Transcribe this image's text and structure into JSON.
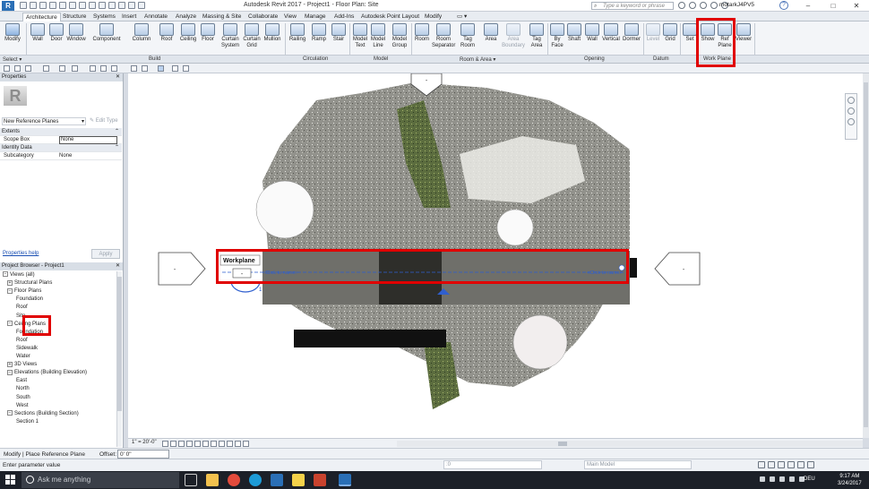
{
  "titlebar": {
    "app_letter": "R",
    "title": "Autodesk Revit 2017 -    Project1 - Floor Plan: Site",
    "search_placeholder": "Type a keyword or phrase",
    "user": "motarkJ4PV5",
    "help": "?",
    "min": "–",
    "max": "□",
    "close": "✕"
  },
  "tabs": [
    "Architecture",
    "Structure",
    "Systems",
    "Insert",
    "Annotate",
    "Analyze",
    "Massing & Site",
    "Collaborate",
    "View",
    "Manage",
    "Add-Ins",
    "Autodesk Point Layout",
    "Modify"
  ],
  "ribbon": {
    "modify": "Modify",
    "select": "Select ▾",
    "build": [
      "Wall",
      "Door",
      "Window",
      "Component",
      "Column",
      "Roof",
      "Ceiling",
      "Floor",
      "Curtain System",
      "Curtain Grid",
      "Mullion"
    ],
    "circulation": [
      "Railing",
      "Ramp",
      "Stair"
    ],
    "model": [
      "Model Text",
      "Model Line",
      "Model Group"
    ],
    "room_area": [
      "Room",
      "Room Separator",
      "Tag Room",
      "Area",
      "Area Boundary",
      "Tag Area"
    ],
    "opening": [
      "By Face",
      "Shaft",
      "Wall",
      "Vertical",
      "Dormer"
    ],
    "datum": [
      "Level",
      "Grid"
    ],
    "work_plane": [
      "Set",
      "Show",
      "Ref Plane",
      "Viewer"
    ],
    "panel_labels": {
      "build": "Build",
      "circulation": "Circulation",
      "model": "Model",
      "room_area": "Room & Area ▾",
      "opening": "Opening",
      "datum": "Datum",
      "work_plane": "Work Plane"
    }
  },
  "properties": {
    "header": "Properties",
    "logo": "R",
    "type": "New Reference Planes",
    "edit_type": "Edit Type",
    "groups": [
      {
        "name": "Extents",
        "rows": [
          {
            "k": "Scope Box",
            "v": "None",
            "boxed": true
          }
        ]
      },
      {
        "name": "Identity Data",
        "rows": [
          {
            "k": "Subcategory",
            "v": "None",
            "boxed": false
          }
        ]
      }
    ],
    "help_link": "Properties help",
    "apply": "Apply"
  },
  "browser": {
    "header": "Project Browser - Project1",
    "items": [
      {
        "label": "Views (all)",
        "indent": 0,
        "tg": "−"
      },
      {
        "label": "Structural Plans",
        "indent": 1,
        "tg": "+"
      },
      {
        "label": "Floor Plans",
        "indent": 1,
        "tg": "−"
      },
      {
        "label": "Foundation",
        "indent": 3,
        "tg": ""
      },
      {
        "label": "Roof",
        "indent": 3,
        "tg": ""
      },
      {
        "label": "Site",
        "indent": 3,
        "tg": "",
        "selected": true
      },
      {
        "label": "Ceiling Plans",
        "indent": 1,
        "tg": "−"
      },
      {
        "label": "Foundation",
        "indent": 3,
        "tg": ""
      },
      {
        "label": "Roof",
        "indent": 3,
        "tg": ""
      },
      {
        "label": "Sidewalk",
        "indent": 3,
        "tg": ""
      },
      {
        "label": "Water",
        "indent": 3,
        "tg": ""
      },
      {
        "label": "3D Views",
        "indent": 1,
        "tg": "+"
      },
      {
        "label": "Elevations (Building Elevation)",
        "indent": 1,
        "tg": "−"
      },
      {
        "label": "East",
        "indent": 3,
        "tg": ""
      },
      {
        "label": "North",
        "indent": 3,
        "tg": ""
      },
      {
        "label": "South",
        "indent": 3,
        "tg": ""
      },
      {
        "label": "West",
        "indent": 3,
        "tg": ""
      },
      {
        "label": "Sections (Building Section)",
        "indent": 1,
        "tg": "−"
      },
      {
        "label": "Section 1",
        "indent": 3,
        "tg": ""
      }
    ]
  },
  "canvas": {
    "workplane_label": "Workplane",
    "click_to_name": "<Click to name>",
    "elev_marker": "-",
    "section_label": "1"
  },
  "viewbar": {
    "scale": "1\" = 20'-0\""
  },
  "options_bar": {
    "mode": "Modify | Place Reference Plane",
    "offset_label": "Offset:",
    "offset_value": "0'  0\""
  },
  "status": {
    "text": "Enter parameter value",
    "field1": ":0",
    "field2": "Main Model"
  },
  "taskbar": {
    "search": "Ask me anything",
    "lang": "DEU",
    "time": "9:17 AM",
    "date": "3/24/2017"
  }
}
